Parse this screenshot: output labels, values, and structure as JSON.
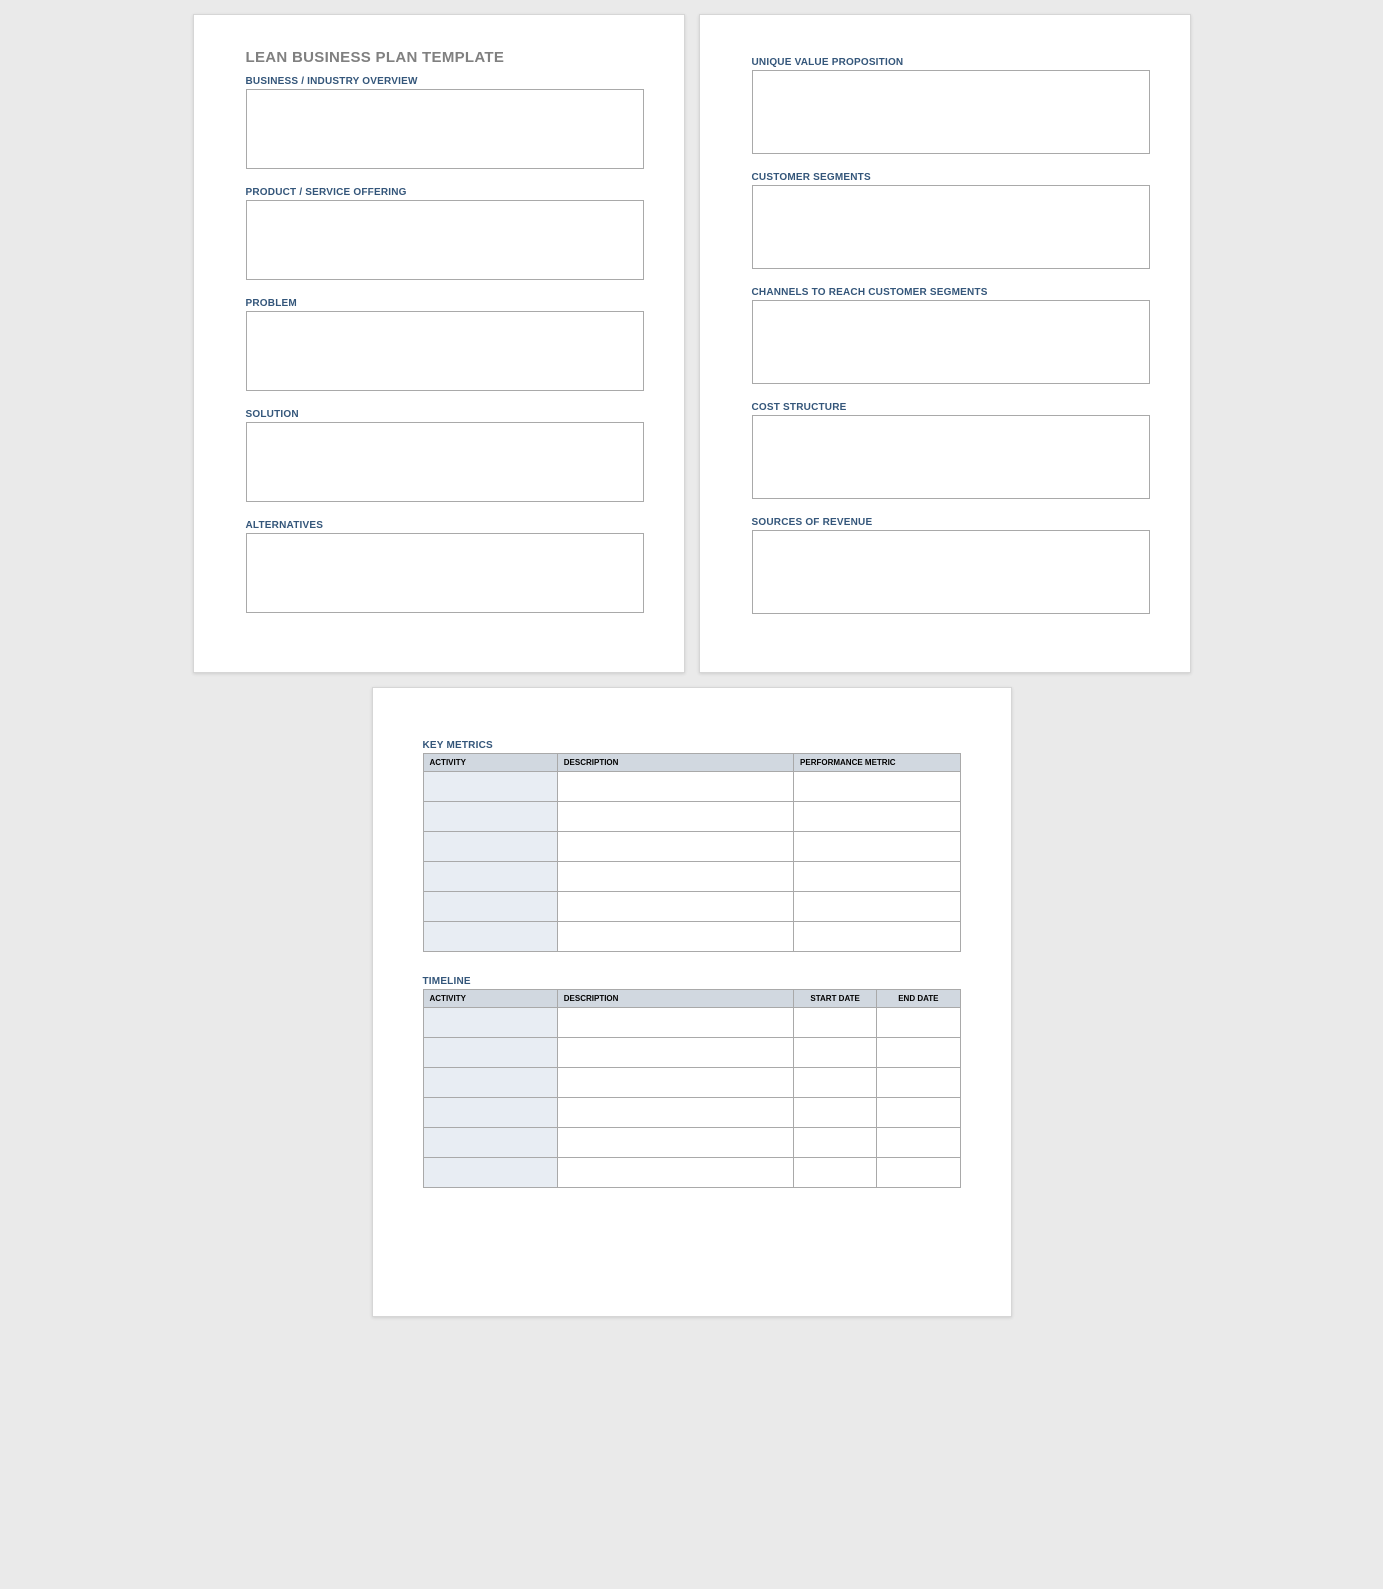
{
  "doc": {
    "title": "LEAN BUSINESS PLAN TEMPLATE"
  },
  "page1": {
    "fields": {
      "business_overview": {
        "label": "BUSINESS / INDUSTRY OVERVIEW",
        "value": ""
      },
      "product_service": {
        "label": "PRODUCT / SERVICE OFFERING",
        "value": ""
      },
      "problem": {
        "label": "PROBLEM",
        "value": ""
      },
      "solution": {
        "label": "SOLUTION",
        "value": ""
      },
      "alternatives": {
        "label": "ALTERNATIVES",
        "value": ""
      }
    }
  },
  "page2": {
    "fields": {
      "uvp": {
        "label": "UNIQUE VALUE PROPOSITION",
        "value": ""
      },
      "segments": {
        "label": "CUSTOMER SEGMENTS",
        "value": ""
      },
      "channels": {
        "label": "CHANNELS TO REACH CUSTOMER SEGMENTS",
        "value": ""
      },
      "cost": {
        "label": "COST STRUCTURE",
        "value": ""
      },
      "revenue": {
        "label": "SOURCES OF REVENUE",
        "value": ""
      }
    }
  },
  "page3": {
    "key_metrics": {
      "title": "KEY METRICS",
      "headers": {
        "activity": "ACTIVITY",
        "description": "DESCRIPTION",
        "metric": "PERFORMANCE METRIC"
      },
      "rows": [
        {
          "activity": "",
          "description": "",
          "metric": ""
        },
        {
          "activity": "",
          "description": "",
          "metric": ""
        },
        {
          "activity": "",
          "description": "",
          "metric": ""
        },
        {
          "activity": "",
          "description": "",
          "metric": ""
        },
        {
          "activity": "",
          "description": "",
          "metric": ""
        },
        {
          "activity": "",
          "description": "",
          "metric": ""
        }
      ]
    },
    "timeline": {
      "title": "TIMELINE",
      "headers": {
        "activity": "ACTIVITY",
        "description": "DESCRIPTION",
        "start": "START DATE",
        "end": "END DATE"
      },
      "rows": [
        {
          "activity": "",
          "description": "",
          "start": "",
          "end": ""
        },
        {
          "activity": "",
          "description": "",
          "start": "",
          "end": ""
        },
        {
          "activity": "",
          "description": "",
          "start": "",
          "end": ""
        },
        {
          "activity": "",
          "description": "",
          "start": "",
          "end": ""
        },
        {
          "activity": "",
          "description": "",
          "start": "",
          "end": ""
        },
        {
          "activity": "",
          "description": "",
          "start": "",
          "end": ""
        }
      ]
    }
  }
}
